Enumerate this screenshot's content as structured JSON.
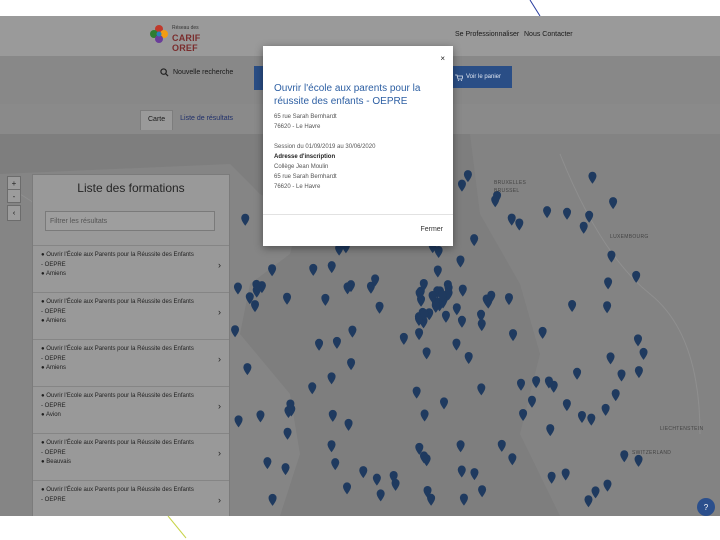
{
  "header": {
    "logo_small": "Réseau des",
    "logo_big": "CARIF OREF",
    "nav_items": [
      "Se Professionnaliser",
      "Nous Contacter"
    ]
  },
  "toolbar": {
    "new_search_label": "Nouvelle recherche",
    "cart_label": "Voir le panier"
  },
  "tabs": [
    {
      "label": "Carte"
    },
    {
      "label": "Liste de résultats"
    }
  ],
  "map": {
    "zoom_in": "+",
    "zoom_out": "-",
    "collapse": "‹",
    "labels": [
      "BRUXELLES",
      "BRUSSEL",
      "LUXEMBOURG",
      "LIECHTENSTEIN",
      "SWITZERLAND"
    ],
    "help": "?"
  },
  "sidebar": {
    "title": "Liste des formations",
    "filter_placeholder": "Filtrer les résultats",
    "items": [
      {
        "line1": "Ouvrir l'École aux Parents pour la Réussite des Enfants",
        "line2": "- OEPRE",
        "city": "Amiens"
      },
      {
        "line1": "Ouvrir l'École aux Parents pour la Réussite des Enfants",
        "line2": "- OEPRE",
        "city": "Amiens"
      },
      {
        "line1": "Ouvrir l'École aux Parents pour la Réussite des Enfants",
        "line2": "- OEPRE",
        "city": "Amiens"
      },
      {
        "line1": "Ouvrir l'Ecole aux Parents pour la Réussite des Enfants",
        "line2": "- OEPRE",
        "city": "Avion"
      },
      {
        "line1": "Ouvrir l'École aux Parents pour la Réussite des Enfants",
        "line2": "- OEPRE",
        "city": "Beauvais"
      },
      {
        "line1": "Ouvrir l'École aux Parents pour la Réussite des Enfants",
        "line2": "- OEPRE",
        "city": ""
      }
    ]
  },
  "modal": {
    "close": "×",
    "title": "Ouvrir l'école aux parents pour la réussite des enfants - OEPRE",
    "address1": "65 rue Sarah Bernhardt",
    "city1": "76620 - Le Havre",
    "session": "Session du 01/09/2019 au 30/06/2020",
    "address_heading": "Adresse d'inscription",
    "school": "Collège Jean Moulin",
    "address2": "65 rue Sarah Bernhardt",
    "city2": "76620 - Le Havre",
    "close_button": "Fermer"
  },
  "colors": {
    "overlay": "#8a8a8a",
    "accent_blue": "#2a4e86",
    "title_blue": "#2d5fa3",
    "marker_dark": "#1f3a5f"
  }
}
